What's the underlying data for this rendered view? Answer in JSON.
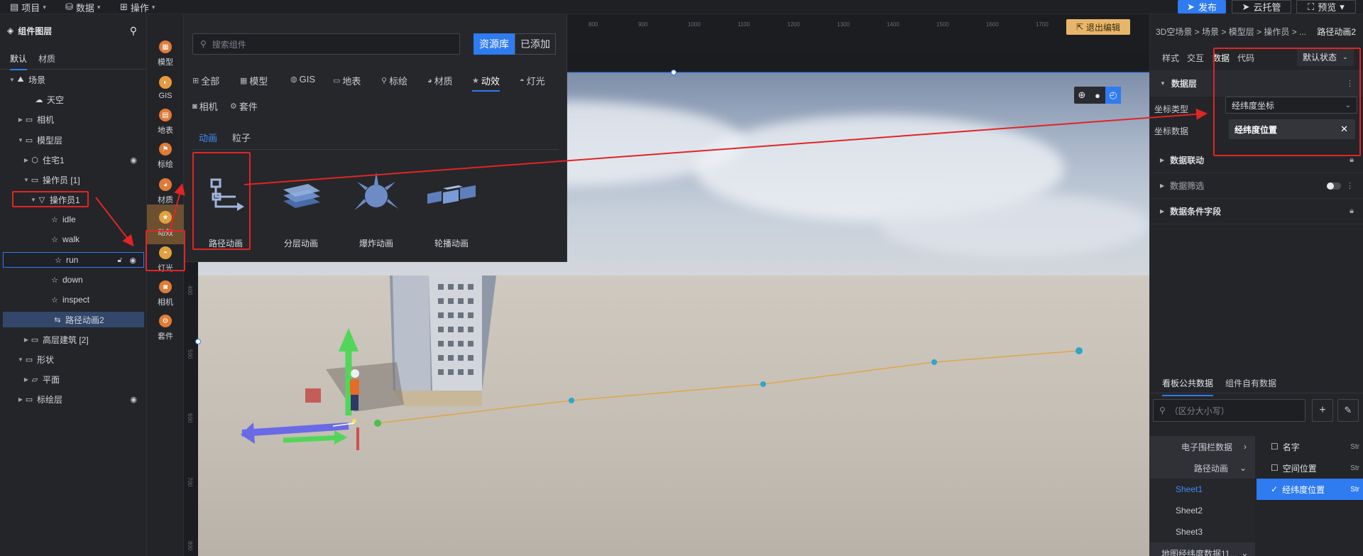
{
  "topbar": {
    "menu": [
      {
        "icon": "document-icon",
        "label": "项目"
      },
      {
        "icon": "database-icon",
        "label": "数据"
      },
      {
        "icon": "grid-icon",
        "label": "操作"
      }
    ],
    "publish_label": "发布",
    "cloud_label": "云托管",
    "preview_label": "预览"
  },
  "tree": {
    "title": "组件图层",
    "tabs": [
      "默认",
      "材质"
    ],
    "nodes": [
      {
        "label": "场景",
        "icon": "scene-icon"
      },
      {
        "label": "天空",
        "icon": "weather-icon"
      },
      {
        "label": "相机",
        "icon": "folder-icon"
      },
      {
        "label": "模型层",
        "icon": "folder-icon"
      },
      {
        "label": "住宅1",
        "icon": "cube-icon"
      },
      {
        "label": "操作员 [1]",
        "icon": "folder-icon"
      },
      {
        "label": "操作员1",
        "icon": "person-model-icon"
      },
      {
        "label": "idle",
        "icon": "star-icon"
      },
      {
        "label": "walk",
        "icon": "star-icon"
      },
      {
        "label": "run",
        "icon": "star-icon"
      },
      {
        "label": "down",
        "icon": "star-icon"
      },
      {
        "label": "inspect",
        "icon": "star-icon"
      },
      {
        "label": "路径动画2",
        "icon": "path-icon"
      },
      {
        "label": "高层建筑 [2]",
        "icon": "folder-icon"
      },
      {
        "label": "形状",
        "icon": "folder-icon"
      },
      {
        "label": "平面",
        "icon": "plane-icon"
      },
      {
        "label": "标绘层",
        "icon": "folder-icon"
      }
    ]
  },
  "iconcol": [
    {
      "label": "模型",
      "icon": "model-icon"
    },
    {
      "label": "GIS",
      "icon": "gis-icon"
    },
    {
      "label": "地表",
      "icon": "terrain-icon"
    },
    {
      "label": "标绘",
      "icon": "marker-icon"
    },
    {
      "label": "材质",
      "icon": "material-icon"
    },
    {
      "label": "动效",
      "icon": "effect-icon"
    },
    {
      "label": "灯光",
      "icon": "light-icon"
    },
    {
      "label": "相机",
      "icon": "camera-icon"
    },
    {
      "label": "套件",
      "icon": "kit-icon"
    }
  ],
  "library": {
    "search_placeholder": "搜索组件",
    "tab_resource": "资源库",
    "tab_added": "已添加",
    "categories": [
      "全部",
      "模型",
      "GIS",
      "地表",
      "标绘",
      "材质",
      "动效",
      "灯光",
      "相机",
      "套件"
    ],
    "subtabs": [
      "动画",
      "粒子"
    ],
    "cards": [
      "路径动画",
      "分层动画",
      "爆炸动画",
      "轮播动画"
    ]
  },
  "viewport": {
    "exit_edit_label": "退出编辑",
    "ruler_top": [
      "800",
      "900",
      "1000",
      "1100",
      "1200",
      "1300",
      "1400",
      "1500",
      "1600",
      "1700"
    ],
    "ruler_left": [
      "400",
      "500",
      "600",
      "700",
      "800"
    ]
  },
  "rpanel": {
    "breadcrumb": "3D空场景 > 场景 > 模型层 > 操作员 > ...",
    "current": "路径动画2",
    "tabs": [
      "样式",
      "交互",
      "数据",
      "代码"
    ],
    "state_label": "默认状态",
    "data_layer": "数据层",
    "coord_type_label": "坐标类型",
    "coord_type_value": "经纬度坐标",
    "coord_data_label": "坐标数据",
    "coord_data_value": "经纬度位置",
    "sections": [
      "数据联动",
      "数据筛选",
      "数据条件字段"
    ],
    "data_tabs": [
      "看板公共数据",
      "组件自有数据"
    ],
    "filter_placeholder": "（区分大小写）",
    "sources": [
      "电子围栏数据",
      "路径动画",
      "Sheet1",
      "Sheet2",
      "Sheet3",
      "地图经纬度数据11..."
    ],
    "fields": [
      {
        "name": "名字",
        "type": "Str"
      },
      {
        "name": "空间位置",
        "type": "Str"
      },
      {
        "name": "经纬度位置",
        "type": "Str"
      }
    ]
  }
}
